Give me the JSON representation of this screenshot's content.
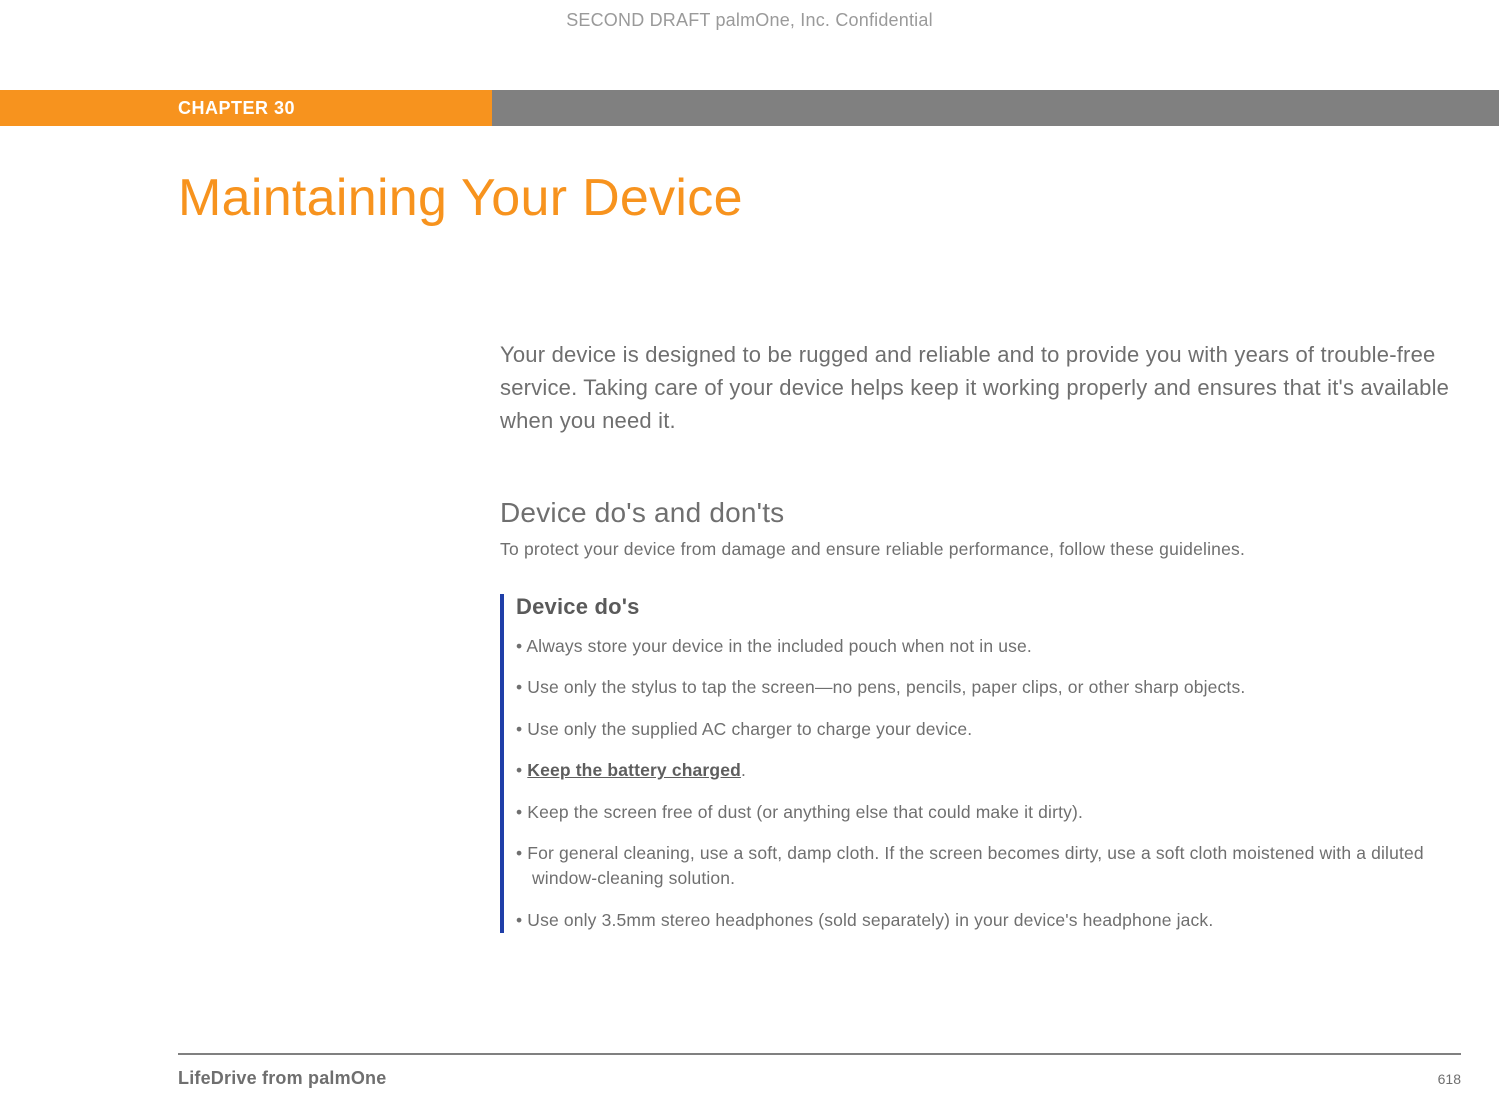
{
  "header": {
    "confidential": "SECOND DRAFT palmOne, Inc.  Confidential"
  },
  "chapter": {
    "label": "CHAPTER 30"
  },
  "title": "Maintaining Your Device",
  "intro": "Your device is designed to be rugged and reliable and to provide you with years of trouble-free service. Taking care of your device helps keep it working properly and ensures that it's available when you need it.",
  "section": {
    "heading": "Device do's and don'ts",
    "subtext": "To protect your device from damage and ensure reliable performance, follow these guidelines."
  },
  "dos": {
    "heading": "Device do's",
    "items": [
      "Always store your device in the included pouch when not in use.",
      "Use only the stylus to tap the screen—no pens, pencils, paper clips, or other sharp objects.",
      "Use only the supplied AC charger to charge your device.",
      "",
      "Keep the screen free of dust (or anything else that could make it dirty).",
      "For general cleaning, use a soft, damp cloth. If the screen becomes dirty, use a soft cloth moistened with a diluted window-cleaning solution.",
      "Use only 3.5mm stereo headphones (sold separately) in your device's headphone jack."
    ],
    "link_item": {
      "text": "Keep the battery charged",
      "trailing": "."
    }
  },
  "footer": {
    "left": "LifeDrive from palmOne",
    "page_number": "618"
  }
}
